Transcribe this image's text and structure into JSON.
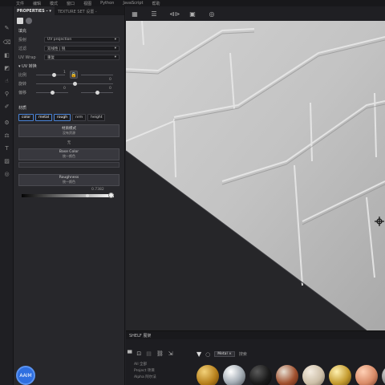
{
  "menubar": {
    "items": [
      "文件",
      "编辑",
      "模式",
      "窗口",
      "视图",
      "Python",
      "JavaScript",
      "帮助"
    ]
  },
  "panel": {
    "tabs": [
      "PROPERTIES - ▾",
      "TEXTURE SET 设置 -"
    ],
    "section_fill": "填充",
    "projection_label": "投射",
    "projection_value": "UV projection",
    "filter_label": "过滤",
    "filter_value": "双线性 | 锐",
    "uvwrap_label": "UV Wrap",
    "uvwrap_value": "重复",
    "uv_transform": "UV 转换",
    "scale_label": "比例",
    "scale_value": "1",
    "rotation_label": "旋转",
    "rotation_value": "0",
    "offset_label": "偏移",
    "offset_value_left": "0",
    "offset_value_right": "0",
    "material_section": "材质",
    "channels": [
      "color",
      "metal",
      "rough",
      "nrm",
      "height"
    ],
    "material_mode": "材质模式",
    "material_mode_sub": "没有资源",
    "no_resource": "无",
    "base_color_label": "Base Color",
    "base_color_sub": "统一颜色",
    "roughness_label": "Roughness",
    "roughness_sub": "统一颜色",
    "roughness_value": "0.7382"
  },
  "viewport_toolbar": [
    "▦",
    "☰",
    "⊲⊳",
    "▣",
    "◎",
    "⊕"
  ],
  "library": {
    "title": "SHELF 展架",
    "side_items": [
      "All 全部",
      "Project 项目",
      "Alpha 阿尔法"
    ],
    "tag": "Metal ×",
    "search_placeholder": "搜索"
  },
  "avatar": {
    "initials": "AAIM"
  },
  "icons": {
    "folder": "folder-icon",
    "filter": "filter-icon",
    "lock": "lock-icon"
  }
}
